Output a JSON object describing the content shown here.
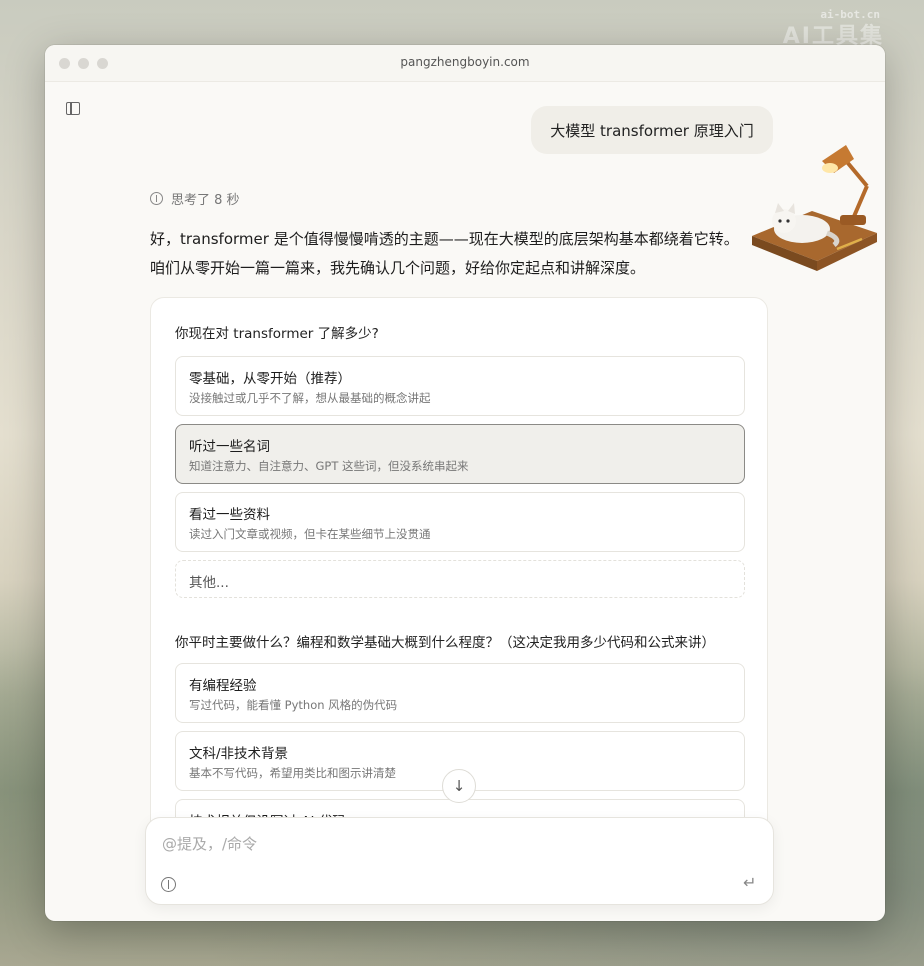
{
  "watermark": {
    "top": "ai-bot.cn",
    "bottom": "AI工具集"
  },
  "window": {
    "url": "pangzhengboyin.com"
  },
  "chat": {
    "user_message": "大模型 transformer 原理入门",
    "thinking_label": "思考了 8 秒",
    "assistant_intro": "好，transformer 是个值得慢慢啃透的主题——现在大模型的底层架构基本都绕着它转。咱们从零开始一篇一篇来，我先确认几个问题，好给你定起点和讲解深度。"
  },
  "questions": [
    {
      "title": "你现在对 transformer 了解多少?",
      "options": [
        {
          "title": "零基础，从零开始（推荐）",
          "desc": "没接触过或几乎不了解，想从最基础的概念讲起",
          "selected": false
        },
        {
          "title": "听过一些名词",
          "desc": "知道注意力、自注意力、GPT 这些词，但没系统串起来",
          "selected": true
        },
        {
          "title": "看过一些资料",
          "desc": "读过入门文章或视频，但卡在某些细节上没贯通",
          "selected": false
        }
      ],
      "other_label": "其他..."
    },
    {
      "title": "你平时主要做什么？编程和数学基础大概到什么程度？（这决定我用多少代码和公式来讲）",
      "options": [
        {
          "title": "有编程经验",
          "desc": "写过代码，能看懂 Python 风格的伪代码",
          "selected": false
        },
        {
          "title": "文科/非技术背景",
          "desc": "基本不写代码，希望用类比和图示讲清楚",
          "selected": false
        },
        {
          "title": "技术相关但没写过 AI 代码",
          "desc": "",
          "selected": false
        }
      ]
    }
  ],
  "composer": {
    "placeholder": "@提及，/命令"
  },
  "colors": {
    "window_bg": "#faf9f6",
    "selected_border": "#8b8a86",
    "bubble_bg": "#f0eee8"
  },
  "icons": [
    "sidebar-toggle-icon",
    "thinking-icon",
    "arrow-down-icon",
    "brain-icon",
    "return-icon",
    "lamp-cat-illustration"
  ]
}
